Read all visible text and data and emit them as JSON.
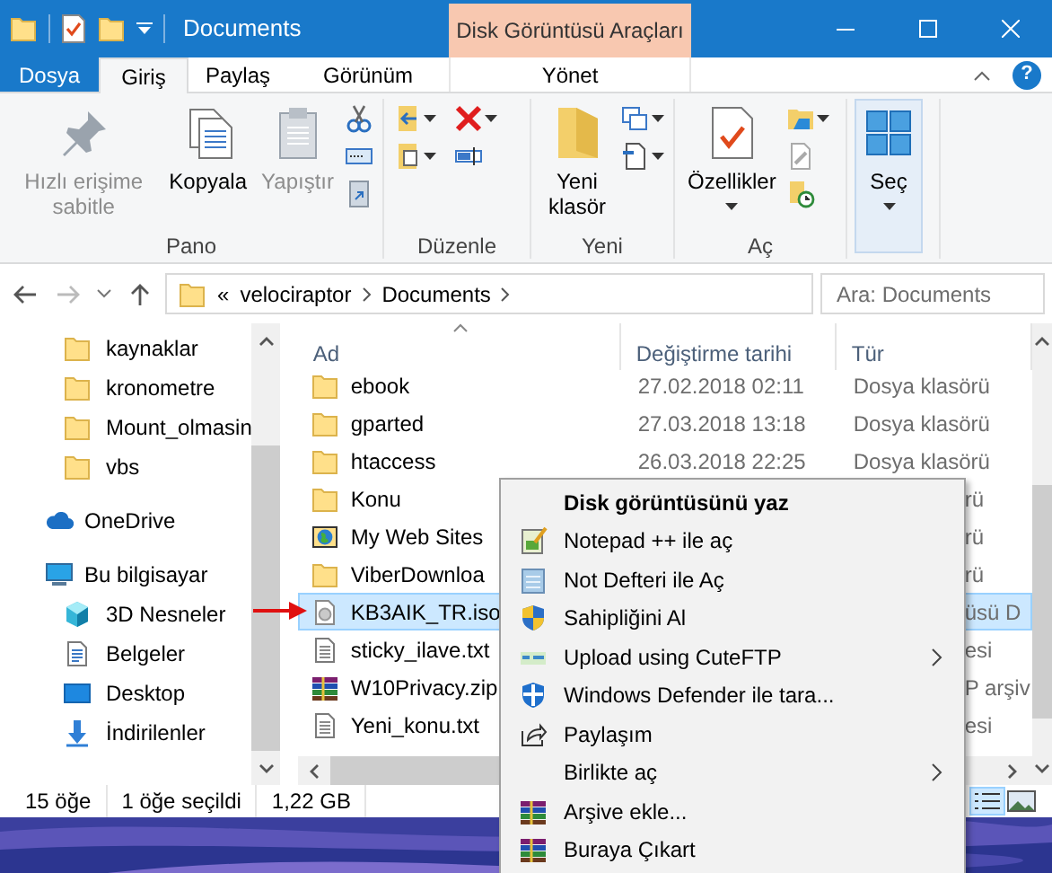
{
  "window": {
    "title": "Documents",
    "context_tab_group": "Disk Görüntüsü Araçları"
  },
  "ribbon_tabs": [
    {
      "label": "Dosya",
      "kind": "file",
      "selected": false
    },
    {
      "label": "Giriş",
      "kind": "tab",
      "selected": true
    },
    {
      "label": "Paylaş",
      "kind": "tab",
      "selected": false
    },
    {
      "label": "Görünüm",
      "kind": "tab",
      "selected": false
    },
    {
      "label": "Yönet",
      "kind": "context",
      "selected": false
    }
  ],
  "help_label": "?",
  "ribbon_groups": [
    {
      "label": "Pano",
      "buttons": [
        {
          "label": "Hızlı erişime sabitle",
          "disabled": true,
          "highlighted": false,
          "dropdown": false
        },
        {
          "label": "Kopyala",
          "disabled": false,
          "highlighted": false,
          "dropdown": false
        },
        {
          "label": "Yapıştır",
          "disabled": true,
          "highlighted": false,
          "dropdown": false
        }
      ]
    },
    {
      "label": "Düzenle"
    },
    {
      "label": "Yeni",
      "buttons": [
        {
          "label": "Yeni klasör",
          "disabled": false,
          "highlighted": false,
          "dropdown": false
        }
      ]
    },
    {
      "label": "Aç",
      "buttons": [
        {
          "label": "Özellikler",
          "disabled": false,
          "highlighted": false,
          "dropdown": true
        }
      ]
    },
    {
      "buttons": [
        {
          "label": "Seç",
          "disabled": false,
          "highlighted": true,
          "dropdown": true
        }
      ]
    }
  ],
  "address": {
    "overflow_marker": "«",
    "path": [
      "velociraptor",
      "Documents"
    ],
    "search_placeholder": "Ara: Documents"
  },
  "nav": [
    {
      "label": "kaynaklar",
      "kind": "folder"
    },
    {
      "label": "kronometre",
      "kind": "folder"
    },
    {
      "label": "Mount_olmasin",
      "kind": "folder"
    },
    {
      "label": "vbs",
      "kind": "folder"
    },
    {
      "label": "OneDrive",
      "kind": "cloud"
    },
    {
      "label": "Bu bilgisayar",
      "kind": "pc",
      "children": [
        {
          "label": "3D Nesneler",
          "kind": "cube"
        },
        {
          "label": "Belgeler",
          "kind": "docs"
        },
        {
          "label": "Desktop",
          "kind": "desktop"
        },
        {
          "label": "İndirilenler",
          "kind": "downloads"
        }
      ]
    }
  ],
  "columns": [
    {
      "label": "Ad",
      "sorted": true
    },
    {
      "label": "Değiştirme tarihi",
      "sorted": false
    },
    {
      "label": "Tür",
      "sorted": false
    }
  ],
  "files": [
    {
      "name": "ebook",
      "kind": "folder",
      "date": "27.02.2018 02:11",
      "type": "Dosya klasörü",
      "selected": false
    },
    {
      "name": "gparted",
      "kind": "folder",
      "date": "27.03.2018 13:18",
      "type": "Dosya klasörü",
      "selected": false
    },
    {
      "name": "htaccess",
      "kind": "folder",
      "date": "26.03.2018 22:25",
      "type": "Dosya klasörü",
      "selected": false
    },
    {
      "name": "Konu",
      "kind": "folder",
      "type": "rü",
      "selected": false
    },
    {
      "name": "My Web Sites",
      "kind": "web",
      "type": "rü",
      "selected": false
    },
    {
      "name": "ViberDownloa",
      "kind": "folder",
      "type": "rü",
      "selected": false
    },
    {
      "name": "KB3AIK_TR.iso",
      "kind": "iso",
      "type": "üsü D",
      "selected": true
    },
    {
      "name": "sticky_ilave.txt",
      "kind": "txt",
      "type": "esi",
      "selected": false
    },
    {
      "name": "W10Privacy.zip",
      "kind": "rar",
      "type": "P arşiv",
      "selected": false
    },
    {
      "name": "Yeni_konu.txt",
      "kind": "txt",
      "type": "esi",
      "selected": false
    }
  ],
  "status_bar": [
    "15 öğe",
    "1 öğe seçildi",
    "1,22 GB"
  ],
  "context_menu": [
    {
      "label": "Disk görüntüsünü yaz",
      "default": true,
      "submenu": false
    },
    {
      "label": "Notepad ++ ile aç",
      "default": false,
      "submenu": false
    },
    {
      "label": "Not Defteri ile Aç",
      "default": false,
      "submenu": false
    },
    {
      "label": "Sahipliğini Al",
      "default": false,
      "submenu": false
    },
    {
      "label": "Upload using CuteFTP",
      "default": false,
      "submenu": true
    },
    {
      "label": "Windows Defender ile tara...",
      "default": false,
      "submenu": false
    },
    {
      "label": "Paylaşım",
      "default": false,
      "submenu": false
    },
    {
      "label": "Birlikte aç",
      "default": false,
      "submenu": true
    },
    {
      "label": "Arşive ekle...",
      "default": false,
      "submenu": false
    },
    {
      "label": "Buraya Çıkart",
      "default": false,
      "submenu": false
    }
  ]
}
